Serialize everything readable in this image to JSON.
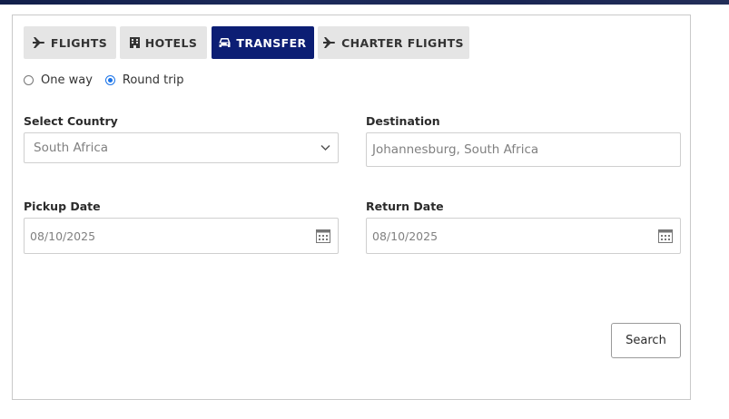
{
  "tabs": {
    "flights": "FLIGHTS",
    "hotels": "HOTELS",
    "transfer": "TRANSFER",
    "charter": "CHARTER FLIGHTS"
  },
  "trip_type": {
    "one_way": "One way",
    "round_trip": "Round trip",
    "selected": "Round trip"
  },
  "country": {
    "label": "Select Country",
    "value": "South Africa"
  },
  "destination": {
    "label": "Destination",
    "value": "Johannesburg, South Africa"
  },
  "pickup": {
    "label": "Pickup Date",
    "value": "08/10/2025"
  },
  "return": {
    "label": "Return Date",
    "value": "08/10/2025"
  },
  "search_label": "Search",
  "colors": {
    "active_tab": "#0c1e74",
    "inactive_tab": "#e5e5e5",
    "radio_accent": "#1a73e8",
    "top_strip": "#1d2b5c"
  },
  "icons": [
    "plane-icon",
    "hotel-icon",
    "car-icon",
    "plane-icon",
    "chevron-down-icon",
    "calendar-icon"
  ]
}
